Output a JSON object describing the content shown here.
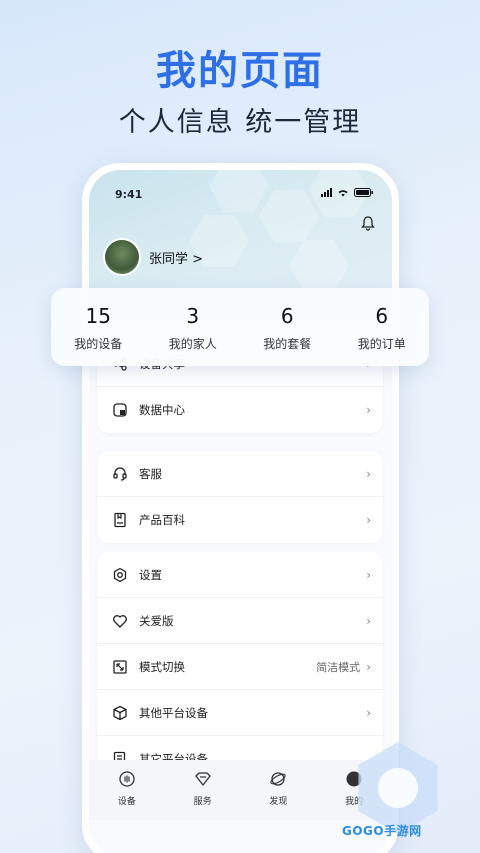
{
  "promo": {
    "title": "我的页面",
    "subtitle": "个人信息  统一管理"
  },
  "status_bar": {
    "time": "9:41"
  },
  "profile": {
    "name": "张同学 >"
  },
  "stats": [
    {
      "value": "15",
      "label": "我的设备"
    },
    {
      "value": "3",
      "label": "我的家人"
    },
    {
      "value": "6",
      "label": "我的套餐"
    },
    {
      "value": "6",
      "label": "我的订单"
    }
  ],
  "menu": {
    "card1": [
      {
        "label": "设备共享",
        "icon": "share-icon"
      },
      {
        "label": "数据中心",
        "icon": "data-center-icon"
      }
    ],
    "card2": [
      {
        "label": "客服",
        "icon": "headset-icon"
      },
      {
        "label": "产品百科",
        "icon": "book-icon"
      }
    ],
    "card3": [
      {
        "label": "设置",
        "icon": "hexagon-settings-icon"
      },
      {
        "label": "关爱版",
        "icon": "heart-icon"
      },
      {
        "label": "模式切换",
        "icon": "mode-switch-icon",
        "value": "简洁模式"
      },
      {
        "label": "其他平台设备",
        "icon": "cube-icon"
      },
      {
        "label": "其它平台设备",
        "icon": "document-icon"
      }
    ]
  },
  "tabbar": [
    {
      "label": "设备",
      "icon": "device-icon"
    },
    {
      "label": "服务",
      "icon": "service-icon"
    },
    {
      "label": "发现",
      "icon": "discover-icon"
    },
    {
      "label": "我的",
      "icon": "profile-icon"
    }
  ],
  "watermark": "GOGO手游网"
}
